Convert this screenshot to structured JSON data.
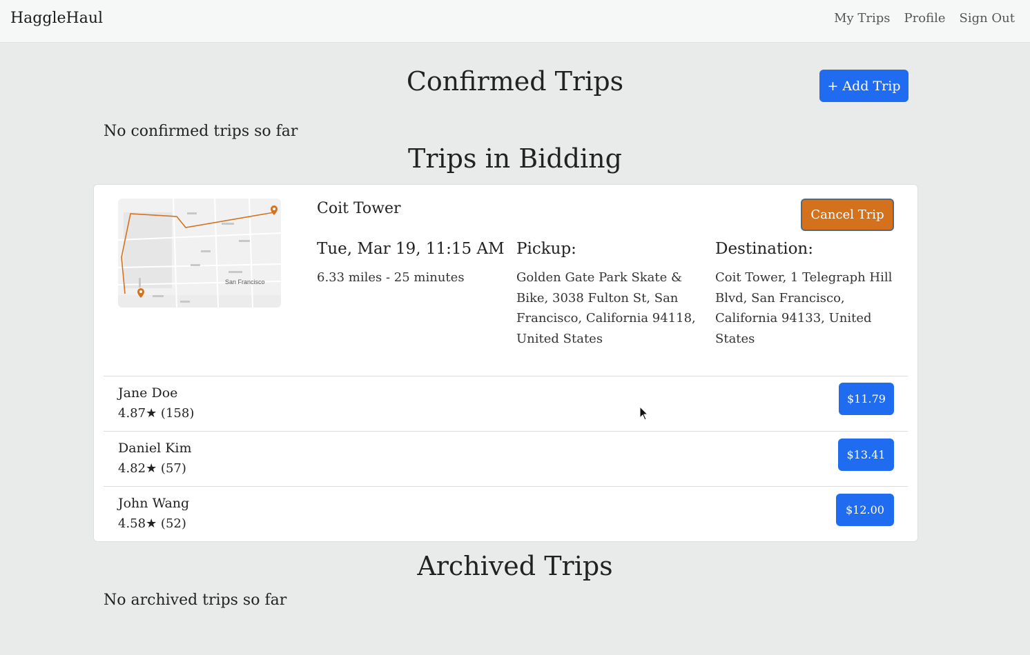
{
  "header": {
    "brand": "HaggleHaul",
    "nav": [
      "My Trips",
      "Profile",
      "Sign Out"
    ]
  },
  "confirmed": {
    "title": "Confirmed Trips",
    "add_button": "+ Add Trip",
    "empty_text": "No confirmed trips so far"
  },
  "bidding": {
    "title": "Trips in Bidding",
    "trip": {
      "name": "Coit Tower",
      "cancel_label": "Cancel Trip",
      "datetime": "Tue, Mar 19, 11:15 AM",
      "distance_time": "6.33 miles - 25 minutes",
      "pickup_label": "Pickup:",
      "pickup_lines": [
        "Golden Gate Park Skate &",
        "Bike, 3038 Fulton St, San",
        "Francisco, California 94118,",
        "United States"
      ],
      "destination_label": "Destination:",
      "destination_lines": [
        "Coit Tower, 1 Telegraph Hill",
        "Blvd, San Francisco,",
        "California 94133, United",
        "States"
      ],
      "map_label": "San Francisco"
    },
    "bids": [
      {
        "driver": "Jane Doe",
        "rating": "4.87★ (158)",
        "price": "$11.79"
      },
      {
        "driver": "Daniel Kim",
        "rating": "4.82★ (57)",
        "price": "$13.41"
      },
      {
        "driver": "John Wang",
        "rating": "4.58★ (52)",
        "price": "$12.00"
      }
    ]
  },
  "archived": {
    "title": "Archived Trips",
    "empty_text": "No archived trips so far"
  },
  "colors": {
    "primary": "#1f6cf1",
    "cancel": "#d4711d",
    "route": "#d4711d",
    "background": "#e9ebea"
  }
}
